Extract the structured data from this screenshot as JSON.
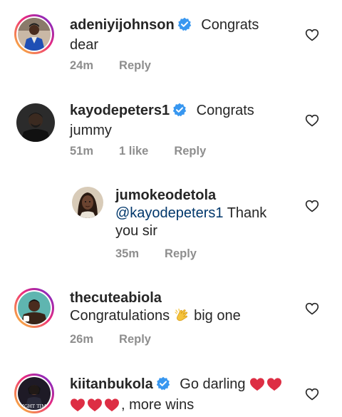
{
  "comments": [
    {
      "username": "adeniyijohnson",
      "verified": true,
      "text_line1": "Congrats",
      "text_line2": "dear",
      "time": "24m",
      "reply": "Reply"
    },
    {
      "username": "kayodepeters1",
      "verified": true,
      "text_line1": "Congrats",
      "text_line2": "jummy",
      "time": "51m",
      "likes": "1 like",
      "reply": "Reply"
    },
    {
      "username": "jumokeodetola",
      "verified": false,
      "mention": "@kayodepeters1",
      "text_line1": "Thank",
      "text_line2": "you sir",
      "time": "35m",
      "reply": "Reply"
    },
    {
      "username": "thecuteabiola",
      "verified": false,
      "text_before": "Congratulations",
      "text_after": "big one",
      "time": "26m",
      "reply": "Reply"
    },
    {
      "username": "kiitanbukola",
      "verified": true,
      "text_line1": "Go darling",
      "text_line2": ", more wins",
      "avatar_caption": "RIGHT TIME"
    }
  ],
  "colors": {
    "verified_blue": "#3897f0",
    "mention": "#00376b",
    "meta_gray": "#8e8e8e",
    "emoji_red": "#dd2e44"
  },
  "icons": [
    "heart-outline-icon",
    "verified-badge-icon",
    "red-heart-emoji-icon",
    "clapping-hands-emoji-icon"
  ]
}
